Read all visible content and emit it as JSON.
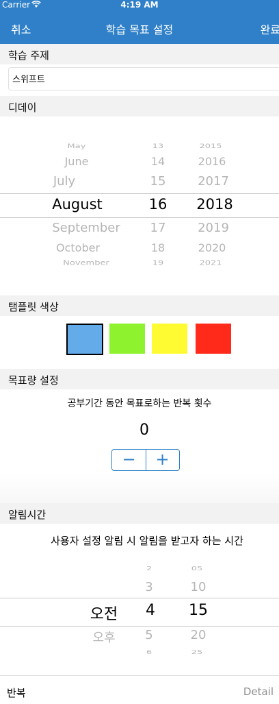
{
  "status_bar": {
    "carrier": "Carrier",
    "time": "4:19 AM"
  },
  "nav": {
    "cancel": "취소",
    "title": "학습 목표 설정",
    "done": "완료"
  },
  "sections": {
    "subject": "학습 주제",
    "dday": "디데이",
    "template_color": "탬플릿 색상",
    "goal_setting": "목표량 설정",
    "alarm_time": "알림시간"
  },
  "subject_field": {
    "value": "스위프트"
  },
  "date_picker": {
    "months": [
      "May",
      "June",
      "July",
      "August",
      "September",
      "October",
      "November"
    ],
    "days": [
      "13",
      "14",
      "15",
      "16",
      "17",
      "18",
      "19"
    ],
    "years": [
      "2015",
      "2016",
      "2017",
      "2018",
      "2019",
      "2020",
      "2021"
    ],
    "selected": {
      "month": "August",
      "day": "16",
      "year": "2018"
    }
  },
  "template_colors": [
    "#64abe9",
    "#8ff22e",
    "#fffb33",
    "#ff2a19"
  ],
  "goal": {
    "description": "공부기간 동안 목표로하는 반복 횟수",
    "count": "0",
    "minus": "−",
    "plus": "+"
  },
  "alarm": {
    "description": "사용자 설정 알림 시 알림을 받고자 하는 시간",
    "ampm": [
      "오전",
      "오후"
    ],
    "hours": [
      "2",
      "3",
      "4",
      "5",
      "6"
    ],
    "minutes": [
      "05",
      "10",
      "15",
      "20",
      "25"
    ],
    "selected": {
      "ampm": "오전",
      "hour": "4",
      "minute": "15"
    }
  },
  "footer": {
    "repeat": "반복",
    "detail": "Detail"
  }
}
